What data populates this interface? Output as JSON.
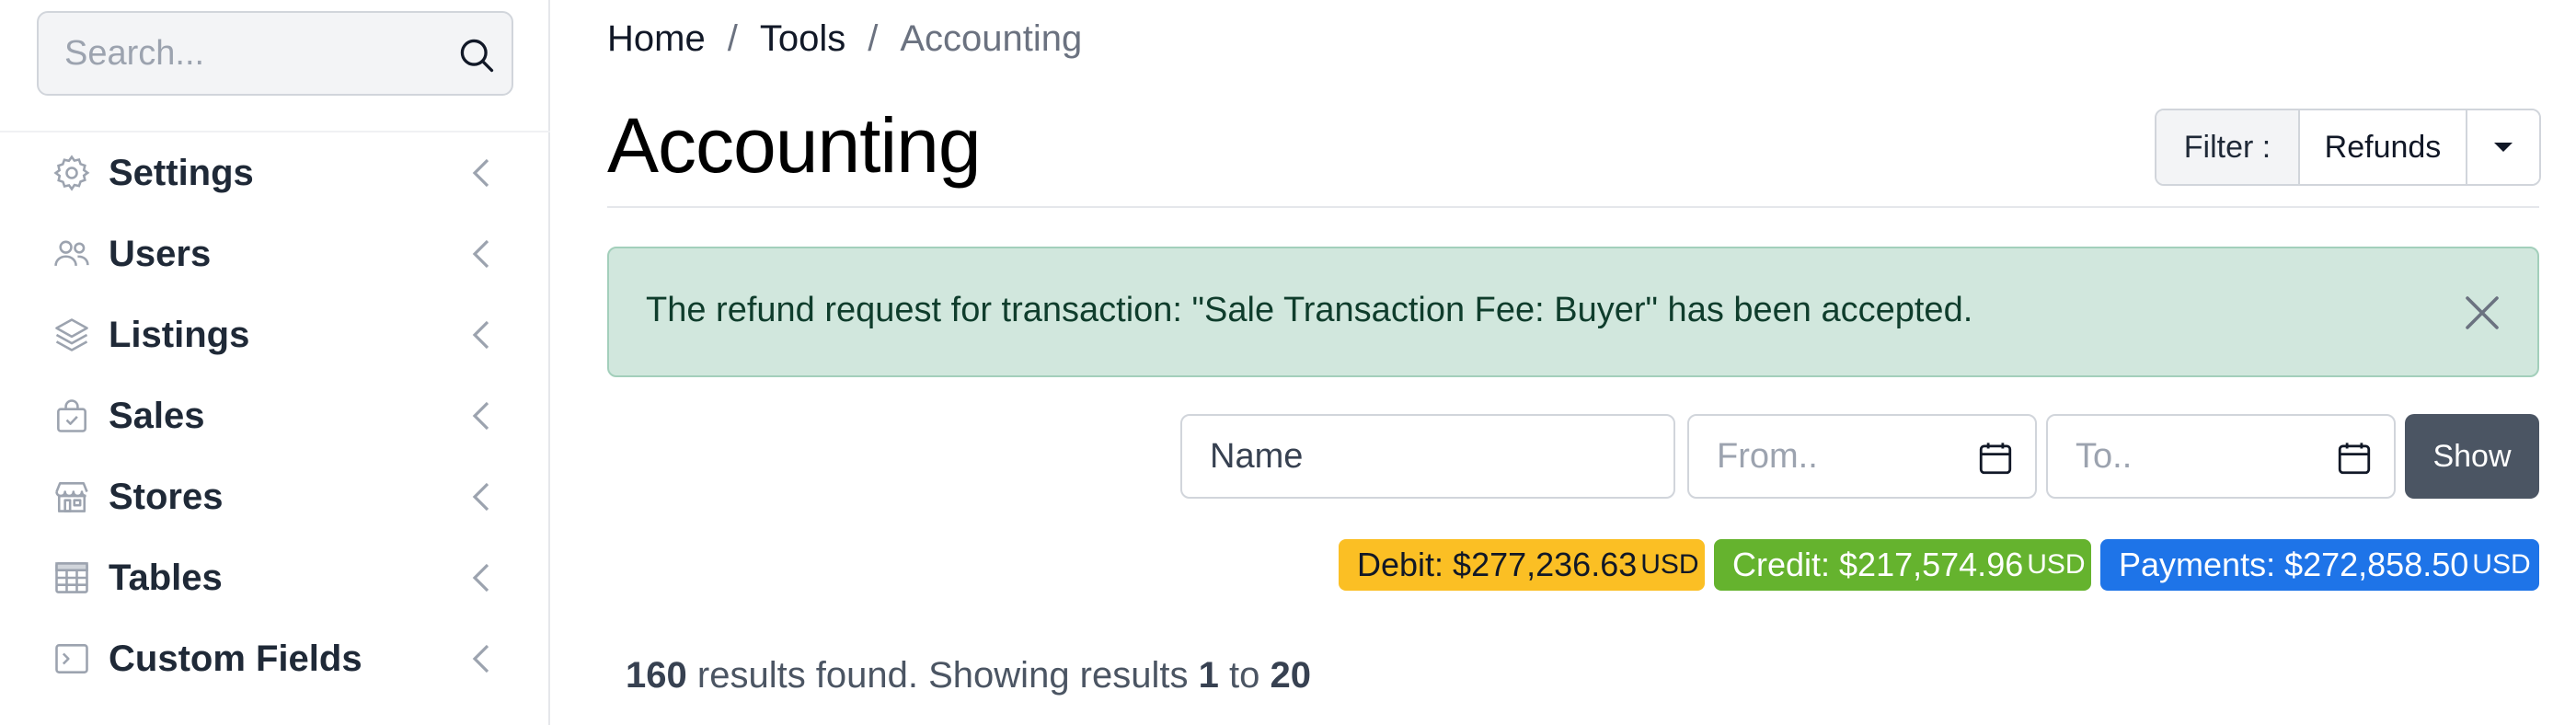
{
  "sidebar": {
    "search": {
      "placeholder": "Search..."
    },
    "items": [
      {
        "label": "Settings",
        "icon": "gear-icon"
      },
      {
        "label": "Users",
        "icon": "users-icon"
      },
      {
        "label": "Listings",
        "icon": "layers-icon"
      },
      {
        "label": "Sales",
        "icon": "shopping-bag-icon"
      },
      {
        "label": "Stores",
        "icon": "store-icon"
      },
      {
        "label": "Tables",
        "icon": "table-icon"
      },
      {
        "label": "Custom Fields",
        "icon": "terminal-icon"
      }
    ]
  },
  "breadcrumb": {
    "items": [
      "Home",
      "Tools"
    ],
    "separator": "/",
    "current": "Accounting"
  },
  "page": {
    "title": "Accounting"
  },
  "filter": {
    "label": "Filter :",
    "value": "Refunds"
  },
  "alert": {
    "message": "The refund request for transaction: \"Sale Transaction Fee: Buyer\" has been accepted.",
    "color": "#d1e7dd"
  },
  "search_form": {
    "name_placeholder": "Name",
    "from_placeholder": "From..",
    "to_placeholder": "To..",
    "show_label": "Show"
  },
  "totals": {
    "debit": {
      "label": "Debit: $277,236.63",
      "currency": "USD",
      "color": "#fbbf24"
    },
    "credit": {
      "label": "Credit: $217,574.96",
      "currency": "USD",
      "color": "#65b32e"
    },
    "payments": {
      "label": "Payments: $272,858.50",
      "currency": "USD",
      "color": "#1e74e8"
    }
  },
  "results": {
    "count": "160",
    "text_found": "results found. Showing results",
    "from": "1",
    "to_word": "to",
    "to": "20"
  }
}
